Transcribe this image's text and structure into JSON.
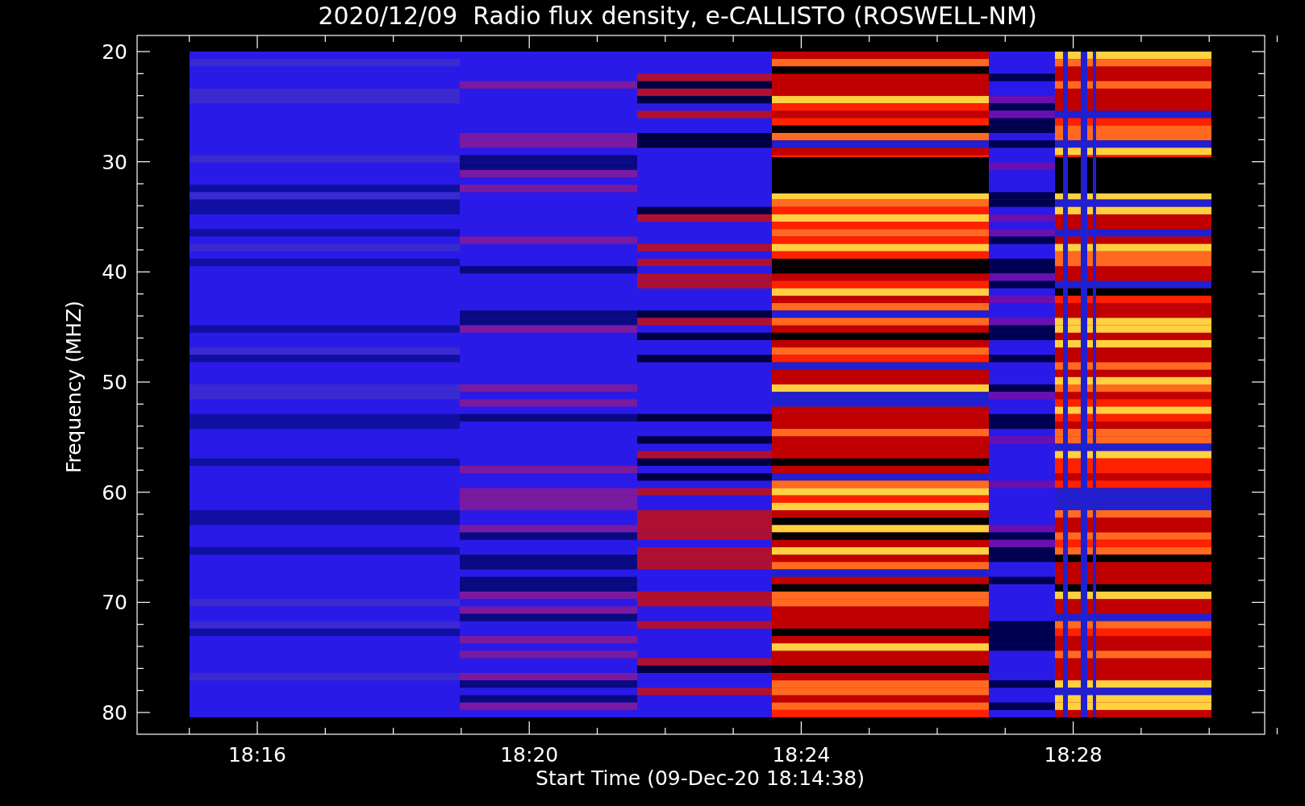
{
  "title": "2020/12/09  Radio flux density, e-CALLISTO (ROSWELL-NM)",
  "y_axis": {
    "label": "Frequency (MHZ)",
    "ticks": [
      "20",
      "30",
      "40",
      "50",
      "60",
      "70",
      "80"
    ]
  },
  "x_axis": {
    "label": "Start Time (09-Dec-20 18:14:38)",
    "ticks": [
      "18:16",
      "18:20",
      "18:24",
      "18:28"
    ]
  }
}
